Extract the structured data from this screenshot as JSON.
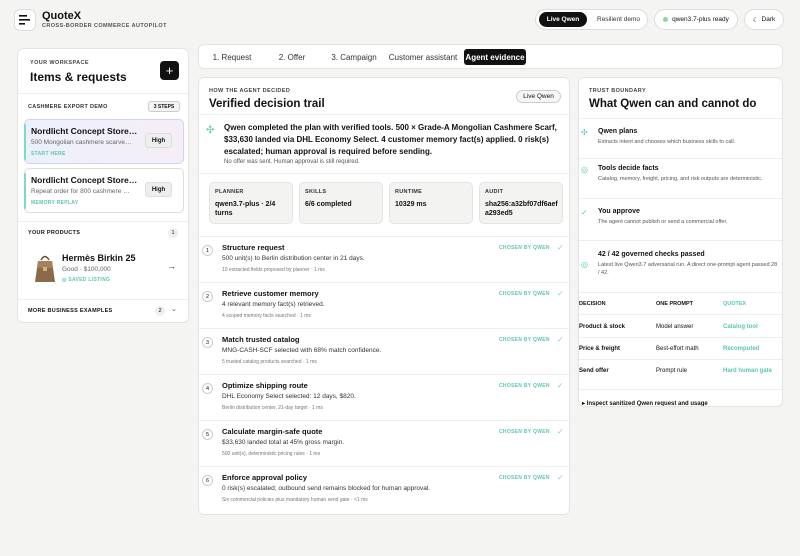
{
  "header": {
    "brand_name": "QuoteX",
    "brand_sub": "CROSS-BORDER COMMERCE AUTOPILOT",
    "mode_live": "Live Qwen",
    "mode_resilient": "Resilient demo",
    "model_status": "qwen3.7-plus ready",
    "theme_label": "Dark"
  },
  "sidebar": {
    "workspace_label": "YOUR WORKSPACE",
    "title": "Items & requests",
    "add_label": "+",
    "demo_label": "CASHMERE EXPORT DEMO",
    "steps_badge": "3 STEPS",
    "requests": [
      {
        "title": "Nordlicht Concept Store…",
        "desc": "500 Mongolian cashmere scarve…",
        "tag": "START HERE",
        "priority": "High"
      },
      {
        "title": "Nordlicht Concept Store…",
        "desc": "Repeat order for 800 cashmere …",
        "tag": "MEMORY REPLAY",
        "priority": "High"
      }
    ],
    "products_label": "YOUR PRODUCTS",
    "products_count": "1",
    "product": {
      "name": "Hermès Birkin 25",
      "meta": "Good · $100,000",
      "saved": "SAVED LISTING"
    },
    "more_label": "MORE BUSINESS EXAMPLES",
    "more_count": "2"
  },
  "tabs": [
    "1. Request",
    "2. Offer",
    "3. Campaign",
    "Customer assistant",
    "Agent evidence"
  ],
  "trail": {
    "how_label": "HOW THE AGENT DECIDED",
    "title": "Verified decision trail",
    "live_badge": "Live Qwen",
    "summary": "Qwen completed the plan with verified tools. 500 × Grade-A Mongolian Cashmere Scarf, $33,630 landed via DHL Economy Select. 4 customer memory fact(s) applied. 0 risk(s) escalated; human approval is required before sending.",
    "summary_note": "No offer was sent. Human approval is still required.",
    "stats": [
      {
        "label": "PLANNER",
        "value": "qwen3.7-plus · 2/4 turns"
      },
      {
        "label": "SKILLS",
        "value": "6/6 completed"
      },
      {
        "label": "RUNTIME",
        "value": "10329 ms"
      },
      {
        "label": "AUDIT",
        "value": "sha256:a32bf07df6aefa293ed5"
      }
    ],
    "chosen_label": "CHOSEN BY QWEN",
    "steps": [
      {
        "num": "1",
        "title": "Structure request",
        "desc": "500 unit(s) to Berlin distribution center in 21 days.",
        "meta": "10 extracted fields proposed by planner · 1 ms"
      },
      {
        "num": "2",
        "title": "Retrieve customer memory",
        "desc": "4 relevant memory fact(s) retrieved.",
        "meta": "4 scoped memory facts searched · 1 ms"
      },
      {
        "num": "3",
        "title": "Match trusted catalog",
        "desc": "MNG-CASH-SCF selected with 68% match confidence.",
        "meta": "5 trusted catalog products searched · 1 ms"
      },
      {
        "num": "4",
        "title": "Optimize shipping route",
        "desc": "DHL Economy Select selected: 12 days, $820.",
        "meta": "Berlin distribution center, 21-day target · 1 ms"
      },
      {
        "num": "5",
        "title": "Calculate margin-safe quote",
        "desc": "$33,630 landed total at 45% gross margin.",
        "meta": "500 unit(s), deterministic pricing rules · 1 ms"
      },
      {
        "num": "6",
        "title": "Enforce approval policy",
        "desc": "0 risk(s) escalated; outbound send remains blocked for human approval.",
        "meta": "Six commercial policies plus mandatory human send gate · <1 ms"
      }
    ]
  },
  "boundary": {
    "label": "TRUST BOUNDARY",
    "title": "What Qwen can and cannot do",
    "items": [
      {
        "title": "Qwen plans",
        "desc": "Extracts intent and chooses which business skills to call."
      },
      {
        "title": "Tools decide facts",
        "desc": "Catalog, memory, freight, pricing, and risk outputs are deterministic."
      },
      {
        "title": "You approve",
        "desc": "The agent cannot publish or send a commercial offer."
      },
      {
        "title": "42 / 42 governed checks passed",
        "desc": "Latest live Qwen3.7 adversarial run. A direct one-prompt agent passed 28 / 42."
      }
    ],
    "table_headers": [
      "DECISION",
      "ONE PROMPT",
      "QUOTEX"
    ],
    "table_rows": [
      {
        "decision": "Product & stock",
        "one_prompt": "Model answer",
        "quotex": "Catalog tool"
      },
      {
        "decision": "Price & freight",
        "one_prompt": "Best-effort math",
        "quotex": "Recomputed"
      },
      {
        "decision": "Send offer",
        "one_prompt": "Prompt rule",
        "quotex": "Hard human gate"
      }
    ],
    "inspect_label": "Inspect sanitized Qwen request and usage"
  }
}
